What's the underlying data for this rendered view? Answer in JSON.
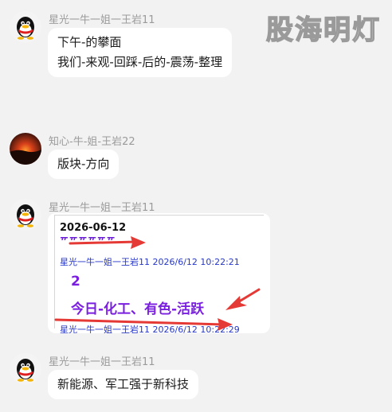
{
  "watermark": "股海明灯",
  "messages": [
    {
      "sender": "星光一牛一姐一王岩11",
      "avatar": "penguin-avatar",
      "lines": [
        "下午-的攀面",
        "我们-来观-回踩-后的-震荡-整理"
      ]
    },
    {
      "sender": "知心-牛-姐-王岩22",
      "avatar": "sunset-avatar",
      "lines": [
        "版块-方向"
      ]
    },
    {
      "sender": "星光一牛一姐一王岩11",
      "avatar": "penguin-avatar",
      "card": {
        "date": "2026-06-12",
        "cut_text": "###### ###",
        "meta": "星光一牛一姐一王岩11 2026/6/12 10:22:21",
        "number": "2",
        "headline": "今日-化工、有色-活跃",
        "meta2": "星光一牛一姐一王岩11 2026/6/12 10:22:29"
      }
    },
    {
      "sender": "星光一牛一姐一王岩11",
      "avatar": "penguin-avatar",
      "lines": [
        "新能源、军工强于新科技"
      ]
    }
  ],
  "colors": {
    "background": "#f2f2f3",
    "bubble": "#ffffff",
    "sender": "#9b9b9b",
    "headline": "#7a1fe0",
    "meta": "#2637c9",
    "arrow": "#e53935"
  }
}
